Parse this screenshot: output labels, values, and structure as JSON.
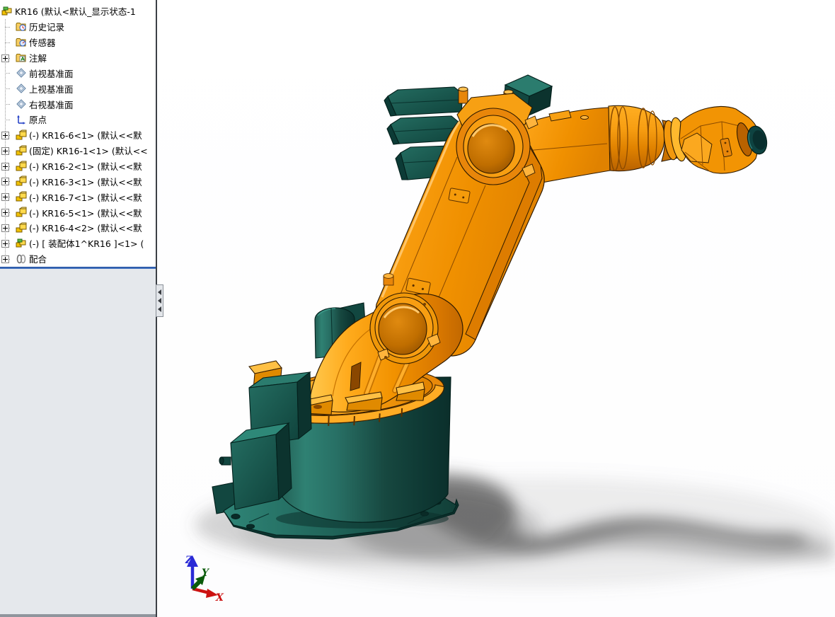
{
  "feature_tree": {
    "root": {
      "label": "KR16  (默认<默认_显示状态-1",
      "icon": "assembly-icon"
    },
    "items": [
      {
        "label": "历史记录",
        "icon": "history-folder-icon",
        "expander": false
      },
      {
        "label": "传感器",
        "icon": "sensors-folder-icon",
        "expander": false
      },
      {
        "label": "注解",
        "icon": "annotations-folder-icon",
        "expander": true
      },
      {
        "label": "前视基准面",
        "icon": "plane-icon",
        "expander": false
      },
      {
        "label": "上视基准面",
        "icon": "plane-icon",
        "expander": false
      },
      {
        "label": "右视基准面",
        "icon": "plane-icon",
        "expander": false
      },
      {
        "label": "原点",
        "icon": "origin-icon",
        "expander": false
      },
      {
        "label": "(-) KR16-6<1> (默认<<默",
        "icon": "part-icon",
        "expander": true
      },
      {
        "label": "(固定) KR16-1<1> (默认<<",
        "icon": "part-icon",
        "expander": true
      },
      {
        "label": "(-) KR16-2<1> (默认<<默",
        "icon": "part-icon",
        "expander": true
      },
      {
        "label": "(-) KR16-3<1> (默认<<默",
        "icon": "part-icon",
        "expander": true
      },
      {
        "label": "(-) KR16-7<1> (默认<<默",
        "icon": "part-icon",
        "expander": true
      },
      {
        "label": "(-) KR16-5<1> (默认<<默",
        "icon": "part-icon",
        "expander": true
      },
      {
        "label": "(-) KR16-4<2> (默认<<默",
        "icon": "part-icon",
        "expander": true
      },
      {
        "label": "(-) [ 装配体1^KR16 ]<1> (",
        "icon": "subassembly-icon",
        "expander": true
      },
      {
        "label": "配合",
        "icon": "mates-icon",
        "expander": true
      }
    ]
  },
  "viewport": {
    "model_name": "KR16 industrial robot arm",
    "triad": {
      "x_label": "X",
      "y_label": "Y",
      "z_label": "Z",
      "x_color": "#cc1111",
      "y_color": "#0a5a0a",
      "z_color": "#2a2ad6"
    },
    "colors": {
      "robot_orange": "#F29200",
      "robot_orange_light": "#FFB429",
      "robot_orange_dark": "#C26800",
      "robot_teal": "#2B7C6E",
      "robot_teal_dark": "#12443E",
      "background": "#FFFFFF"
    }
  },
  "panel": {
    "split_line_color": "#3061AE",
    "lower_pane_color": "#E5E8EC"
  }
}
